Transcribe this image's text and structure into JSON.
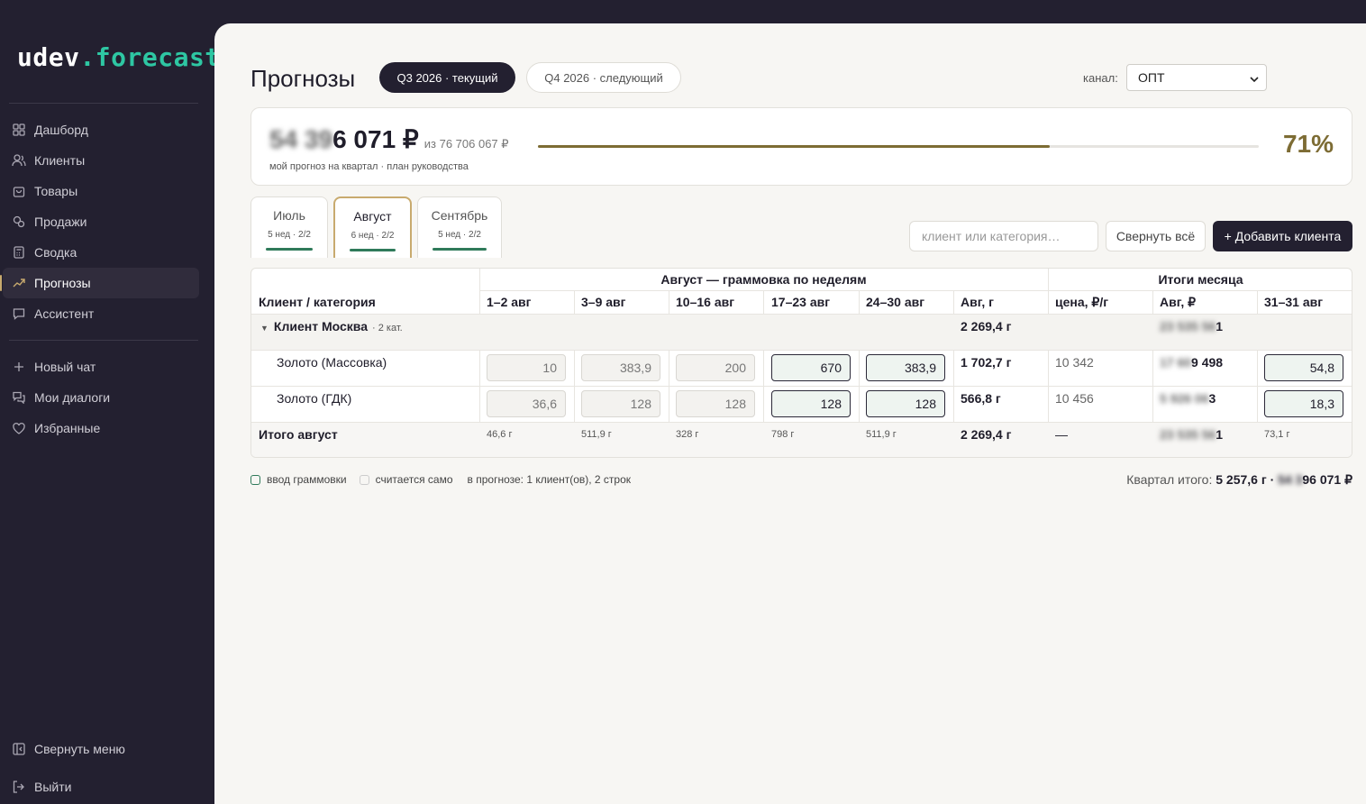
{
  "sidebar": {
    "logo_main": "udev",
    "logo_accent": ".forecast",
    "nav": [
      {
        "label": "Дашборд",
        "icon": "dashboard-icon"
      },
      {
        "label": "Клиенты",
        "icon": "users-icon"
      },
      {
        "label": "Товары",
        "icon": "bag-icon"
      },
      {
        "label": "Продажи",
        "icon": "sales-icon"
      },
      {
        "label": "Сводка",
        "icon": "calculator-icon"
      },
      {
        "label": "Прогнозы",
        "icon": "trend-icon"
      },
      {
        "label": "Ассистент",
        "icon": "chat-icon"
      }
    ],
    "chat": [
      {
        "label": "Новый чат",
        "icon": "plus-icon"
      },
      {
        "label": "Мои диалоги",
        "icon": "dialogs-icon"
      },
      {
        "label": "Избранные",
        "icon": "heart-icon"
      }
    ],
    "collapse_label": "Свернуть меню",
    "logout_label": "Выйти"
  },
  "header": {
    "title": "Прогнозы",
    "quarter_current": "Q3 2026 · текущий",
    "quarter_next": "Q4 2026 · следующий",
    "channel_label": "канал:",
    "channel_value": "ОПТ"
  },
  "summary": {
    "amount_hidden": "54 39",
    "amount_visible": "6 071 ₽",
    "of_text": "из 76 706 067 ₽",
    "subtitle": "мой прогноз на квартал · план руководства",
    "progress": 0.71,
    "percent": "71%"
  },
  "months": [
    {
      "name": "Июль",
      "sub": "5 нед · 2/2"
    },
    {
      "name": "Август",
      "sub": "6 нед · 2/2"
    },
    {
      "name": "Сентябрь",
      "sub": "5 нед · 2/2"
    }
  ],
  "toolbar": {
    "search_placeholder": "клиент или категория…",
    "collapse_all": "Свернуть всё",
    "add_client": "+ Добавить клиента"
  },
  "table": {
    "group_weekly": "Август — граммовка по неделям",
    "group_totals": "Итоги месяца",
    "col_client": "Клиент / категория",
    "weeks": [
      "1–2 авг",
      "3–9 авг",
      "10–16 авг",
      "17–23 авг",
      "24–30 авг"
    ],
    "col_avg_g": "Авг, г",
    "col_price": "цена, ₽/г",
    "col_avg_rub": "Авг, ₽",
    "col_last": "31–31 авг",
    "client": {
      "name": "Клиент Москва",
      "cats": "· 2 кат.",
      "total_g": "2 269,4 г",
      "total_rub_hidden": "23 535 56",
      "total_rub_visible": "1"
    },
    "rows": [
      {
        "name": "Золото (Массовка)",
        "weeks": [
          "10",
          "383,9",
          "200",
          "670",
          "383,9"
        ],
        "total_g": "1 702,7 г",
        "price": "10 342",
        "rub_hidden": "17 60",
        "rub_visible": "9 498",
        "last": "54,8"
      },
      {
        "name": "Золото (ГДК)",
        "weeks": [
          "36,6",
          "128",
          "128",
          "128",
          "128"
        ],
        "total_g": "566,8 г",
        "price": "10 456",
        "rub_hidden": "5 926 06",
        "rub_visible": "3",
        "last": "18,3"
      }
    ],
    "totals": {
      "label": "Итого август",
      "weeks": [
        "46,6 г",
        "511,9 г",
        "328 г",
        "798 г",
        "511,9 г"
      ],
      "total_g": "2 269,4 г",
      "price": "—",
      "rub_hidden": "23 535 56",
      "rub_visible": "1",
      "last": "73,1 г"
    }
  },
  "legend": {
    "input": "ввод граммовки",
    "auto": "считается само",
    "count": "в прогнозе: 1 клиент(ов), 2 строк"
  },
  "quarter_total": {
    "label": "Квартал итого:",
    "grams": "5 257,6 г ·",
    "rub_hidden": "54 3",
    "rub_visible": "96 071 ₽"
  }
}
